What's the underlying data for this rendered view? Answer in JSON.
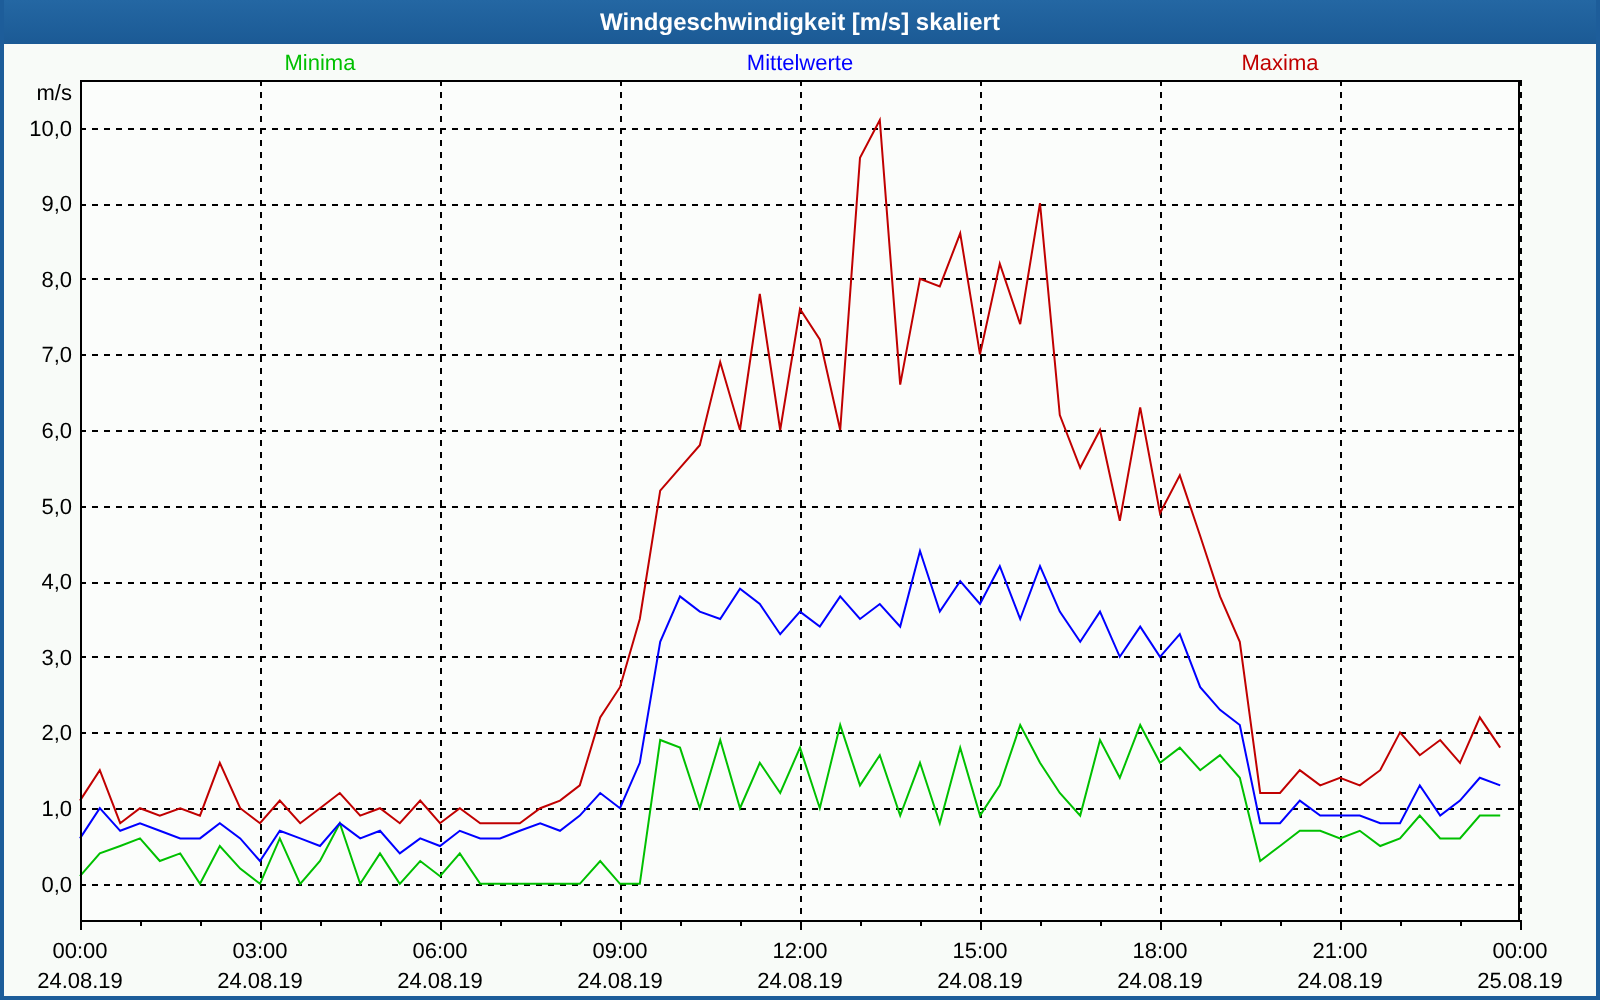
{
  "window": {
    "title": "Windgeschwindigkeit [m/s] skaliert"
  },
  "chart": {
    "chart_data": {
      "type": "line",
      "ylabel": "m/s",
      "xlim": [
        0,
        24
      ],
      "ylim": [
        -0.48,
        10.63
      ],
      "grid": true,
      "xticks": [
        {
          "value": 0,
          "label": "00:00"
        },
        {
          "value": 3,
          "label": "03:00"
        },
        {
          "value": 6,
          "label": "06:00"
        },
        {
          "value": 9,
          "label": "09:00"
        },
        {
          "value": 12,
          "label": "12:00"
        },
        {
          "value": 15,
          "label": "15:00"
        },
        {
          "value": 18,
          "label": "18:00"
        },
        {
          "value": 21,
          "label": "21:00"
        },
        {
          "value": 24,
          "label": "00:00"
        }
      ],
      "annotations": [
        "24.08.19",
        "24.08.19",
        "24.08.19",
        "24.08.19",
        "24.08.19",
        "24.08.19",
        "24.08.19",
        "24.08.19",
        "25.08.19"
      ],
      "yticks": [
        {
          "value": 0,
          "label": "0,0"
        },
        {
          "value": 1,
          "label": "1,0"
        },
        {
          "value": 2,
          "label": "2,0"
        },
        {
          "value": 3,
          "label": "3,0"
        },
        {
          "value": 4,
          "label": "4,0"
        },
        {
          "value": 5,
          "label": "5,0"
        },
        {
          "value": 6,
          "label": "6,0"
        },
        {
          "value": 7,
          "label": "7,0"
        },
        {
          "value": 8,
          "label": "8,0"
        },
        {
          "value": 9,
          "label": "9,0"
        },
        {
          "value": 10,
          "label": "10,0"
        }
      ],
      "x": [
        0,
        0.33,
        0.67,
        1,
        1.33,
        1.67,
        2,
        2.33,
        2.67,
        3,
        3.33,
        3.67,
        4,
        4.33,
        4.67,
        5,
        5.33,
        5.67,
        6,
        6.33,
        6.67,
        7,
        7.33,
        7.67,
        8,
        8.33,
        8.67,
        9,
        9.33,
        9.67,
        10,
        10.33,
        10.67,
        11,
        11.33,
        11.67,
        12,
        12.33,
        12.67,
        13,
        13.33,
        13.67,
        14,
        14.33,
        14.67,
        15,
        15.33,
        15.67,
        16,
        16.33,
        16.67,
        17,
        17.33,
        17.67,
        18,
        18.33,
        18.67,
        19,
        19.33,
        19.67,
        20,
        20.33,
        20.67,
        21,
        21.33,
        21.67,
        22,
        22.33,
        22.67,
        23,
        23.33,
        23.67
      ],
      "series": [
        {
          "name": "Minima",
          "color": "#00c000",
          "values": [
            0.1,
            0.4,
            0.5,
            0.6,
            0.3,
            0.4,
            0.0,
            0.5,
            0.2,
            0.0,
            0.6,
            0.0,
            0.3,
            0.8,
            0.0,
            0.4,
            0.0,
            0.3,
            0.1,
            0.4,
            0.0,
            0.0,
            0.0,
            0.0,
            0.0,
            0.0,
            0.3,
            0.0,
            0.0,
            1.9,
            1.8,
            1.0,
            1.9,
            1.0,
            1.6,
            1.2,
            1.8,
            1.0,
            2.1,
            1.3,
            1.7,
            0.9,
            1.6,
            0.8,
            1.8,
            0.9,
            1.3,
            2.1,
            1.6,
            1.2,
            0.9,
            1.9,
            1.4,
            2.1,
            1.6,
            1.8,
            1.5,
            1.7,
            1.4,
            0.3,
            0.5,
            0.7,
            0.7,
            0.6,
            0.7,
            0.5,
            0.6,
            0.9,
            0.6,
            0.6,
            0.9,
            0.9
          ]
        },
        {
          "name": "Mittelwerte",
          "color": "#0000ff",
          "values": [
            0.6,
            1.0,
            0.7,
            0.8,
            0.7,
            0.6,
            0.6,
            0.8,
            0.6,
            0.3,
            0.7,
            0.6,
            0.5,
            0.8,
            0.6,
            0.7,
            0.4,
            0.6,
            0.5,
            0.7,
            0.6,
            0.6,
            0.7,
            0.8,
            0.7,
            0.9,
            1.2,
            1.0,
            1.6,
            3.2,
            3.8,
            3.6,
            3.5,
            3.9,
            3.7,
            3.3,
            3.6,
            3.4,
            3.8,
            3.5,
            3.7,
            3.4,
            4.4,
            3.6,
            4.0,
            3.7,
            4.2,
            3.5,
            4.2,
            3.6,
            3.2,
            3.6,
            3.0,
            3.4,
            3.0,
            3.3,
            2.6,
            2.3,
            2.1,
            0.8,
            0.8,
            1.1,
            0.9,
            0.9,
            0.9,
            0.8,
            0.8,
            1.3,
            0.9,
            1.1,
            1.4,
            1.3
          ]
        },
        {
          "name": "Maxima",
          "color": "#c00000",
          "values": [
            1.1,
            1.5,
            0.8,
            1.0,
            0.9,
            1.0,
            0.9,
            1.6,
            1.0,
            0.8,
            1.1,
            0.8,
            1.0,
            1.2,
            0.9,
            1.0,
            0.8,
            1.1,
            0.8,
            1.0,
            0.8,
            0.8,
            0.8,
            1.0,
            1.1,
            1.3,
            2.2,
            2.6,
            3.5,
            5.2,
            5.5,
            5.8,
            6.9,
            6.0,
            7.8,
            6.0,
            7.6,
            7.2,
            6.0,
            9.6,
            10.1,
            6.6,
            8.0,
            7.9,
            8.6,
            7.0,
            8.2,
            7.4,
            9.0,
            6.2,
            5.5,
            6.0,
            4.8,
            6.3,
            4.9,
            5.4,
            4.6,
            3.8,
            3.2,
            1.2,
            1.2,
            1.5,
            1.3,
            1.4,
            1.3,
            1.5,
            2.0,
            1.7,
            1.9,
            1.6,
            2.2,
            1.8
          ]
        }
      ]
    }
  }
}
